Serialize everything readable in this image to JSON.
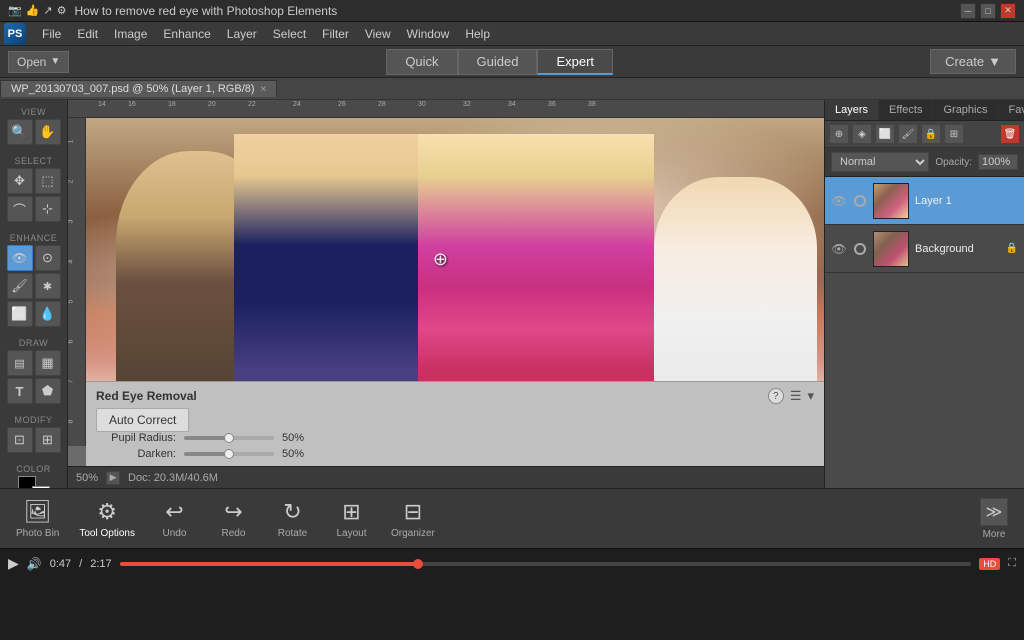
{
  "title_bar": {
    "title": "How to remove red eye with Photoshop Elements",
    "icons": [
      "camera-icon",
      "hand-icon",
      "share-icon",
      "settings-icon"
    ],
    "controls": [
      "minimize",
      "maximize",
      "close"
    ]
  },
  "menu_bar": {
    "logo": "PS",
    "items": [
      "File",
      "Edit",
      "Image",
      "Enhance",
      "Layer",
      "Select",
      "Filter",
      "View",
      "Window",
      "Help"
    ]
  },
  "mode_bar": {
    "open_label": "Open",
    "modes": [
      "Quick",
      "Guided",
      "Expert"
    ],
    "active_mode": "Expert",
    "create_label": "Create"
  },
  "tab_bar": {
    "file_name": "WP_20130703_007.psd @ 50% (Layer 1, RGB/8)",
    "close_symbol": "×"
  },
  "canvas": {
    "zoom": "50%",
    "doc_info": "Doc: 20.3M/40.6M",
    "scroll_arrow": "▶"
  },
  "red_eye_panel": {
    "title": "Red Eye Removal",
    "auto_correct_label": "Auto Correct",
    "pupil_radius_label": "Pupil Radius:",
    "pupil_radius_value": "50%",
    "darken_label": "Darken:",
    "darken_value": "50%",
    "help_icon": "?",
    "menu_icon": "☰",
    "close_icon": "▾"
  },
  "layers_panel": {
    "tabs": [
      "Layers",
      "Effects",
      "Graphics",
      "Favorites"
    ],
    "active_tab": "Layers",
    "blend_mode": "Normal",
    "opacity_label": "Opacity:",
    "opacity_value": "100%",
    "toolbar_icons": [
      "new-adjustment",
      "new-fill",
      "blend",
      "lock-transparent",
      "lock-image",
      "lock-all",
      "lock-position",
      "trash"
    ],
    "layers": [
      {
        "name": "Layer 1",
        "visible": true,
        "selected": true,
        "lock_symbol": ""
      },
      {
        "name": "Background",
        "visible": true,
        "selected": false,
        "lock_symbol": "🔒"
      }
    ]
  },
  "bottom_toolbar": {
    "tools": [
      {
        "id": "photo-bin",
        "label": "Photo Bin",
        "icon": "🖼"
      },
      {
        "id": "tool-options",
        "label": "Tool Options",
        "icon": "⚙"
      },
      {
        "id": "undo",
        "label": "Undo",
        "icon": "↩"
      },
      {
        "id": "redo",
        "label": "Redo",
        "icon": "↪"
      },
      {
        "id": "rotate",
        "label": "Rotate",
        "icon": "↻"
      },
      {
        "id": "layout",
        "label": "Layout",
        "icon": "⊞"
      },
      {
        "id": "organizer",
        "label": "Organizer",
        "icon": "⊟"
      }
    ],
    "more_label": "More",
    "more_icon": "≫"
  },
  "video_bar": {
    "play_icon": "▶",
    "volume_icon": "🔊",
    "time_current": "0:47",
    "time_total": "2:17",
    "progress_percent": 35,
    "hd_badge": "HD"
  },
  "left_toolbar": {
    "sections": [
      {
        "label": "VIEW",
        "tools": [
          {
            "id": "zoom",
            "icon": "🔍",
            "active": false
          },
          {
            "id": "hand",
            "icon": "✋",
            "active": false
          }
        ]
      },
      {
        "label": "SELECT",
        "tools": [
          {
            "id": "move",
            "icon": "✥",
            "active": false
          },
          {
            "id": "marquee",
            "icon": "⬚",
            "active": false
          },
          {
            "id": "lasso",
            "icon": "⌒",
            "active": false
          },
          {
            "id": "magic-wand",
            "icon": "⊹",
            "active": false
          }
        ]
      },
      {
        "label": "ENHANCE",
        "tools": [
          {
            "id": "redeye",
            "icon": "👁",
            "active": true
          },
          {
            "id": "spot-heal",
            "icon": "⊙",
            "active": false
          },
          {
            "id": "brush",
            "icon": "🖌",
            "active": false
          },
          {
            "id": "clone",
            "icon": "🔵",
            "active": false
          },
          {
            "id": "eraser",
            "icon": "⬜",
            "active": false
          },
          {
            "id": "blur",
            "icon": "💧",
            "active": false
          }
        ]
      },
      {
        "label": "DRAW",
        "tools": [
          {
            "id": "paint-bucket",
            "icon": "🪣",
            "active": false
          },
          {
            "id": "gradient",
            "icon": "▦",
            "active": false
          },
          {
            "id": "type",
            "icon": "T",
            "active": false
          },
          {
            "id": "custom-shape",
            "icon": "⬟",
            "active": false
          }
        ]
      },
      {
        "label": "MODIFY",
        "tools": [
          {
            "id": "crop",
            "icon": "⊡",
            "active": false
          },
          {
            "id": "recompose",
            "icon": "⊞",
            "active": false
          }
        ]
      },
      {
        "label": "COLOR",
        "tools": [
          {
            "id": "foreground-color",
            "icon": "■",
            "active": false
          },
          {
            "id": "background-color",
            "icon": "□",
            "active": false
          }
        ]
      }
    ]
  }
}
